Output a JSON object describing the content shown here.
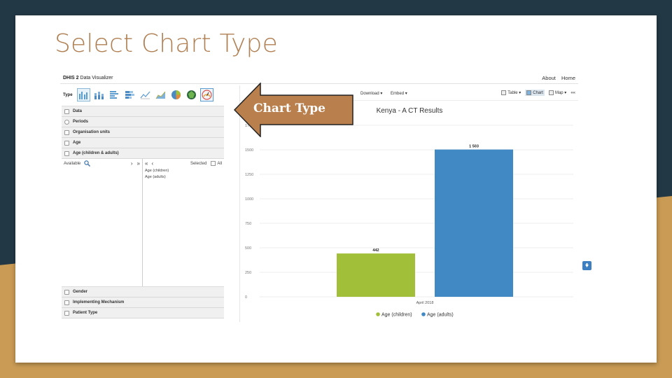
{
  "slide": {
    "title": "Select Chart Type"
  },
  "app": {
    "name_bold": "DHIS 2",
    "name_rest": " Data Visualizer",
    "top_links": [
      "About",
      "Home"
    ]
  },
  "left": {
    "type_label": "Type",
    "type_icons": [
      "column-chart-icon",
      "stacked-column-icon",
      "bar-chart-icon",
      "stacked-bar-icon",
      "line-chart-icon",
      "area-chart-icon",
      "pie-chart-icon",
      "radar-chart-icon",
      "gauge-chart-icon"
    ],
    "sections_top": [
      "Data",
      "Periods",
      "Organisation units",
      "Age",
      "Age (children & adults)"
    ],
    "available_label": "Available",
    "selected_label": "Selected",
    "all_label": "All",
    "selected_items": [
      "Age (children)",
      "Age (adults)"
    ],
    "sections_bottom": [
      "Gender",
      "Implementing Mechanism",
      "Patient Type"
    ]
  },
  "toolbar": {
    "left_items": [
      "Download ▾",
      "Embed ▾"
    ],
    "right_items": [
      "Table ▾",
      "Chart",
      "Map ▾",
      "««"
    ]
  },
  "callout": {
    "text": "Chart Type"
  },
  "colors": {
    "children": "#a1bf38",
    "adults": "#4189c4",
    "accent": "#b07f52",
    "callout": "#b97f4c"
  },
  "chart_data": {
    "type": "bar",
    "title": "Kenya - A CT Results",
    "categories": [
      "April 2018"
    ],
    "series": [
      {
        "name": "Age (children)",
        "values": [
          442
        ],
        "label": "442"
      },
      {
        "name": "Age (adults)",
        "values": [
          1503
        ],
        "label": "1 503"
      }
    ],
    "yticks": [
      "0",
      "250",
      "500",
      "750",
      "1000",
      "1250",
      "1500",
      "1750"
    ],
    "ylim": [
      0,
      1750
    ],
    "grid": true,
    "legend": "bottom"
  }
}
